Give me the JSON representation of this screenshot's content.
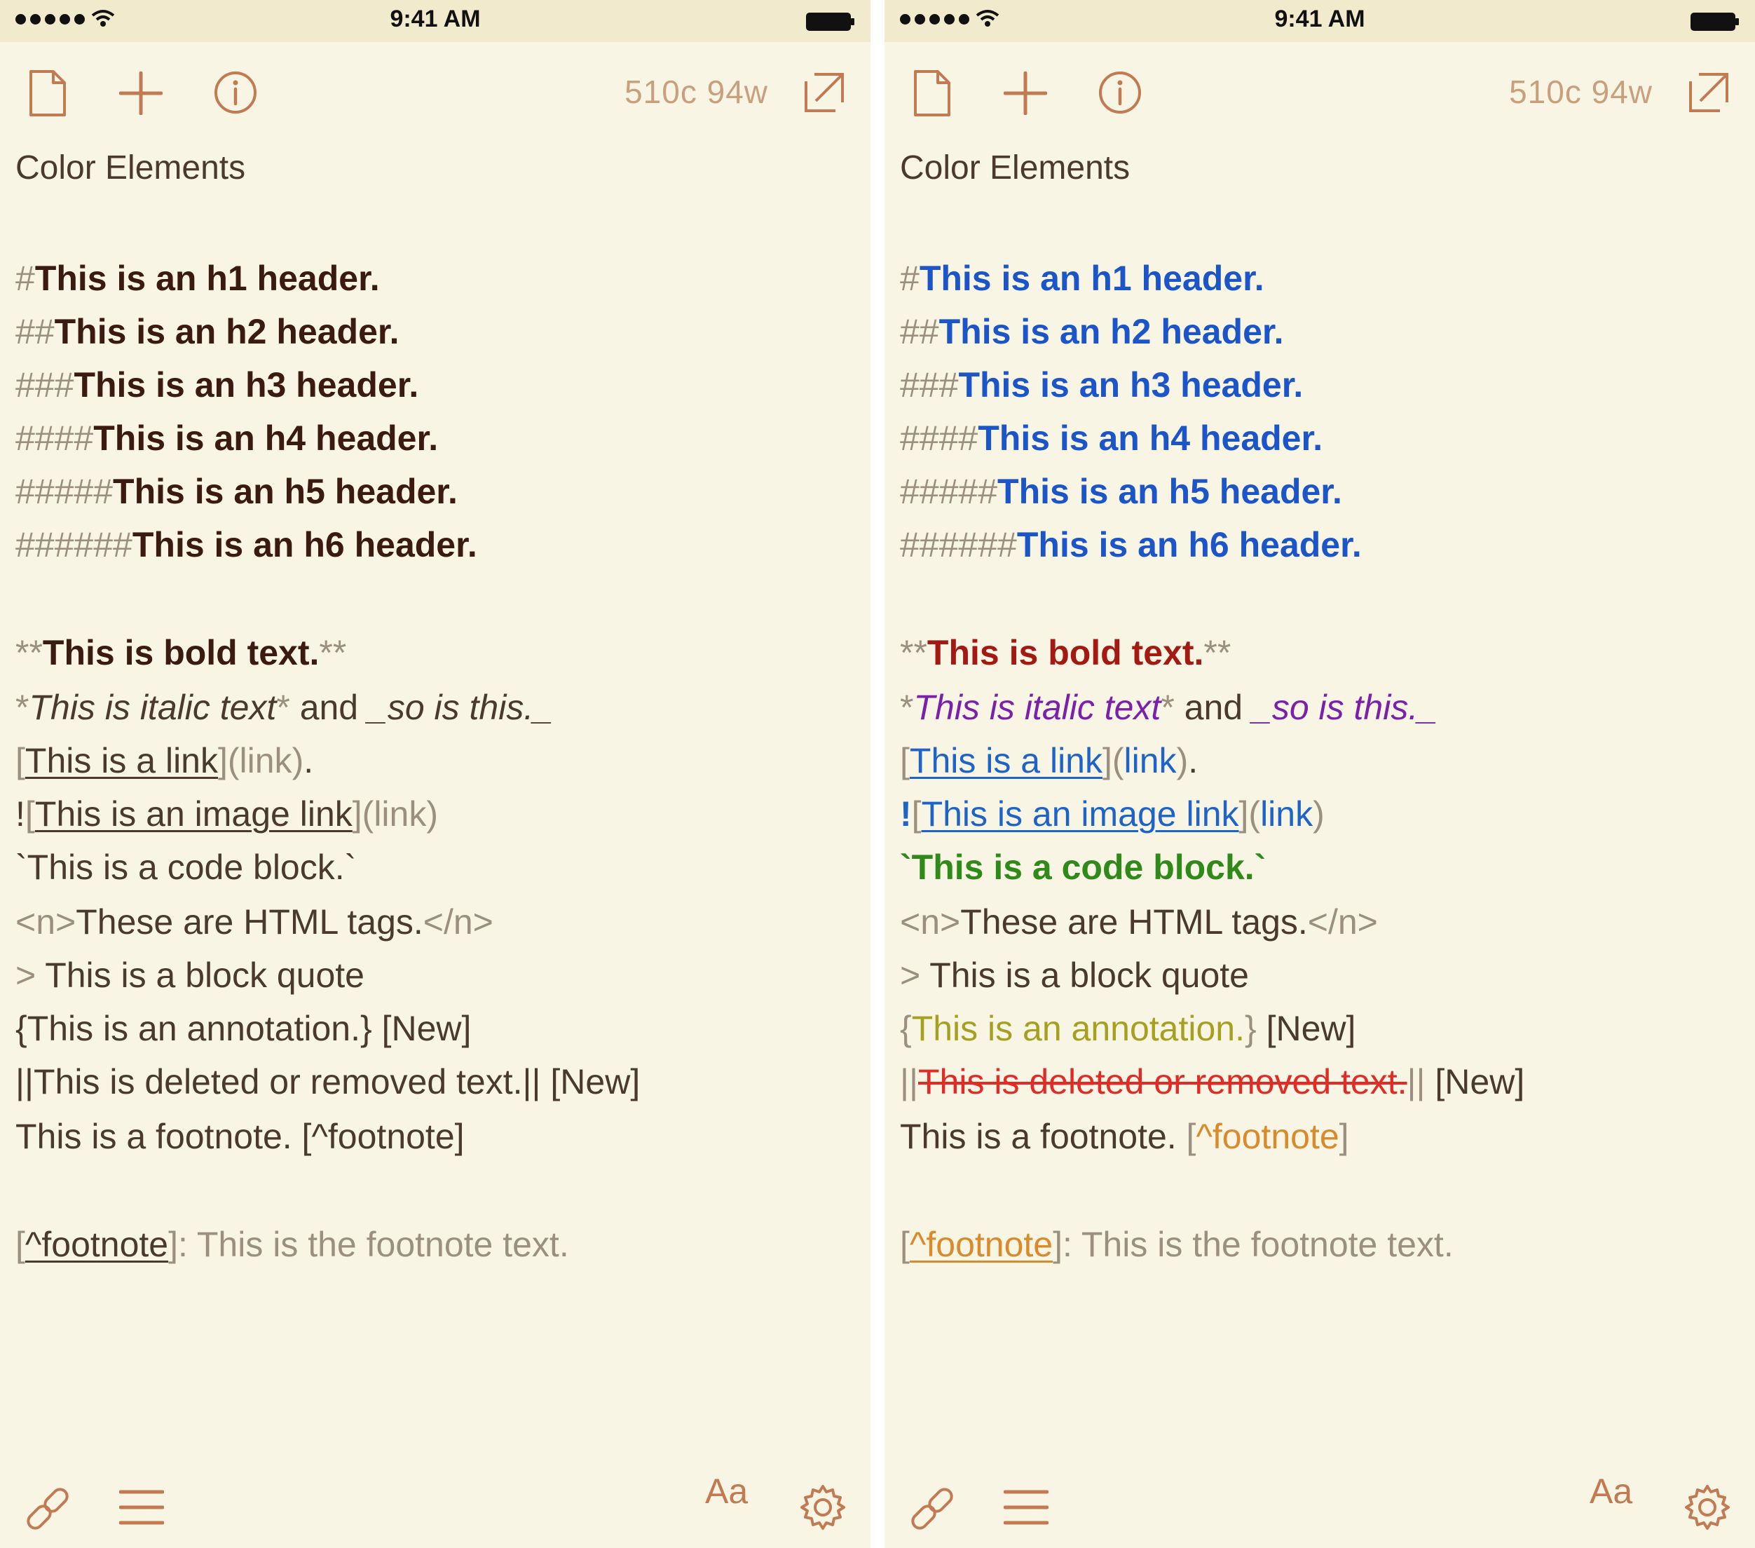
{
  "status_bar": {
    "time": "9:41 AM"
  },
  "toolbar": {
    "word_count": "510c 94w",
    "icons": [
      "document-icon",
      "plus-icon",
      "info-icon",
      "expand-icon"
    ]
  },
  "document": {
    "title": "Color Elements"
  },
  "editor": {
    "h1": {
      "marker": "#",
      "text": "This is an h1 header."
    },
    "h2": {
      "marker": "##",
      "text": "This is an h2 header."
    },
    "h3": {
      "marker": "###",
      "text": "This is an h3 header."
    },
    "h4": {
      "marker": "####",
      "text": "This is an h4 header."
    },
    "h5": {
      "marker": "#####",
      "text": "This is an h5 header."
    },
    "h6": {
      "marker": "######",
      "text": "This is an h6 header."
    },
    "bold": {
      "open": "**",
      "text": "This is bold text.",
      "close": "**"
    },
    "italic": {
      "open": "*",
      "text": "This is italic text",
      "close": "*",
      "middle": " and ",
      "text2": "_so is this._"
    },
    "link": {
      "open": "[",
      "text": "This is a link",
      "mid": "](",
      "target": "link",
      "close": ")",
      "tail": "."
    },
    "image_link": {
      "bang": "!",
      "open": "[",
      "text": "This is an image link",
      "mid": "](",
      "target": "link",
      "close": ")"
    },
    "code": {
      "text": "`This is a code block.`"
    },
    "html": {
      "open": "<n>",
      "text": "These are HTML tags.",
      "close": "</n>"
    },
    "quote": {
      "marker": ">",
      "text": " This is a block quote"
    },
    "annotation": {
      "open": "{",
      "text": "This is an annotation.",
      "close": "}",
      "tag": " [New]"
    },
    "deleted": {
      "open": "||",
      "text": "This is deleted or removed text.",
      "close": "||",
      "tag": " [New]"
    },
    "footnote_ref": {
      "text": "This is a footnote. ",
      "open": "[",
      "ref": "^footnote",
      "close": "]"
    },
    "footnote_def": {
      "open": "[",
      "ref": "^footnote",
      "close": "]",
      "text": ": This is the footnote text."
    }
  },
  "bottom_bar": {
    "font_label": "Aa",
    "icons": [
      "link-icon",
      "list-icon",
      "gear-icon"
    ]
  },
  "colors": {
    "background": "#f9f5e4",
    "status_bar": "#f2eacc",
    "accent": "#c27a52",
    "header_plain": "#3b1a10",
    "header_colored": "#1b55c8",
    "bold": "#a31a13",
    "italic": "#7b20a8",
    "link": "#1e63c8",
    "code": "#2f8a1a",
    "annotation": "#a6a021",
    "deleted": "#e12b26",
    "footnote": "#d98a2a"
  }
}
